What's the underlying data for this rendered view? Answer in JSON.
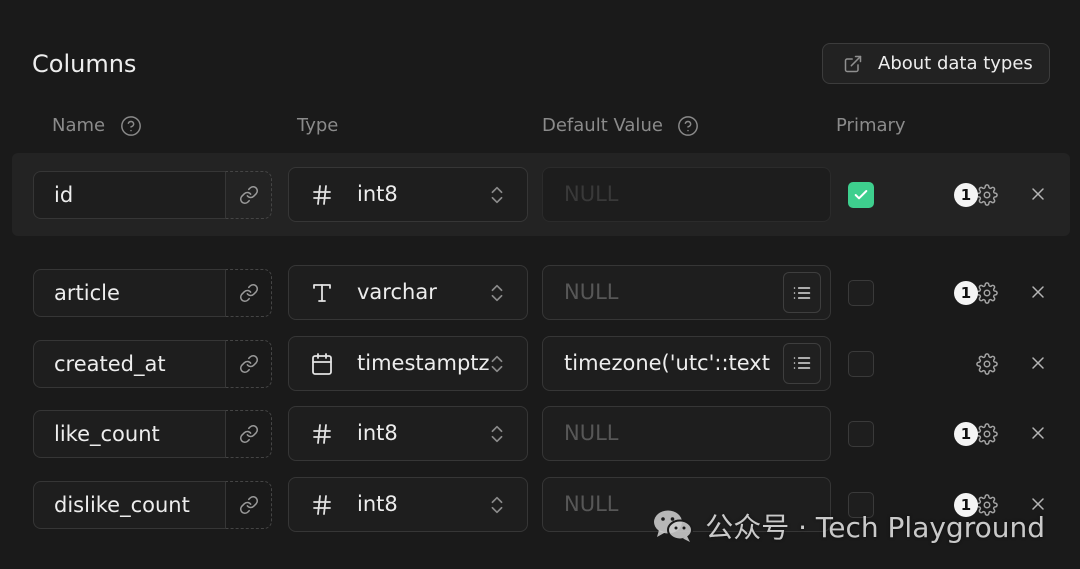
{
  "section": {
    "title": "Columns",
    "about_button": {
      "label": "About data types",
      "icon": "external-link-icon"
    }
  },
  "headers": {
    "name": "Name",
    "name_help_icon": "help-circle-icon",
    "type": "Type",
    "default_value": "Default Value",
    "default_value_help_icon": "help-circle-icon",
    "primary": "Primary"
  },
  "row_icons": {
    "name_link": "link-icon",
    "type_chevrons": "chevrons-up-down-icon",
    "default_menu": "list-icon",
    "primary_check": "check-icon",
    "settings": "gear-icon",
    "remove": "close-icon"
  },
  "columns": [
    {
      "name": "id",
      "type": "int8",
      "type_icon": "hash-icon",
      "default_value": "",
      "default_placeholder": "NULL",
      "default_disabled": true,
      "default_menu": false,
      "primary": true,
      "badge": "1",
      "highlighted": true
    },
    {
      "name": "article",
      "type": "varchar",
      "type_icon": "text-type-icon",
      "default_value": "",
      "default_placeholder": "NULL",
      "default_menu": true,
      "primary": false,
      "badge": "1"
    },
    {
      "name": "created_at",
      "type": "timestamptz",
      "type_icon": "calendar-icon",
      "default_value": "timezone('utc'::text",
      "default_menu": true,
      "primary": false,
      "badge": null
    },
    {
      "name": "like_count",
      "type": "int8",
      "type_icon": "hash-icon",
      "default_value": "",
      "default_placeholder": "NULL",
      "default_menu": false,
      "primary": false,
      "badge": "1"
    },
    {
      "name": "dislike_count",
      "type": "int8",
      "type_icon": "hash-icon",
      "default_value": "",
      "default_placeholder": "NULL",
      "default_menu": false,
      "primary": false,
      "badge": "1"
    }
  ],
  "watermark": {
    "text": "公众号 · Tech Playground",
    "icon": "wechat-icon"
  },
  "colors": {
    "background": "#1a1a1a",
    "row_highlight": "#232323",
    "field_background": "#1e1e1e",
    "border": "#363636",
    "text": "#ededed",
    "muted_text": "#8b8b8b",
    "placeholder": "#575757",
    "primary_green": "#3ecf8e"
  }
}
